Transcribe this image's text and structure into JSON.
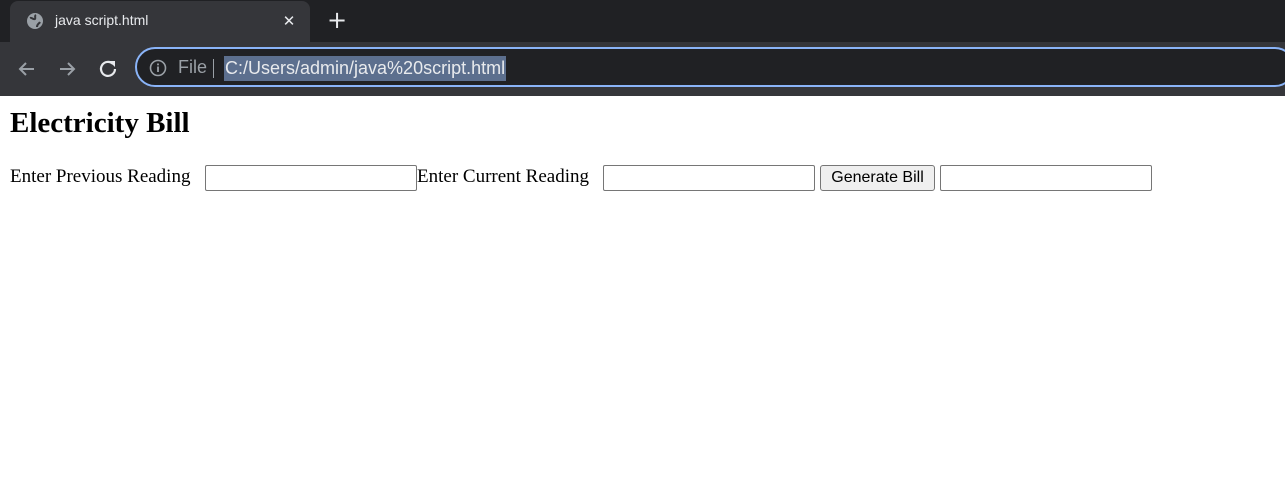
{
  "browser": {
    "tab_title": "java script.html",
    "tab_close": "✕",
    "new_tab": "+",
    "omnibox_scheme": "File",
    "url": "C:/Users/admin/java%20script.html",
    "icons": [
      "globe-icon",
      "close-icon",
      "plus-icon",
      "back-arrow-icon",
      "forward-arrow-icon",
      "reload-icon",
      "info-icon"
    ]
  },
  "page": {
    "heading": "Electricity Bill",
    "previous_label": "Enter Previous Reading",
    "previous_value": "",
    "current_label": "Enter Current Reading",
    "current_value": "",
    "button_label": "Generate Bill",
    "result_value": ""
  },
  "colors": {
    "titlebar": "#202124",
    "toolbar": "#35363a",
    "omnibox_focus": "#8ab4f8",
    "url_selection": "#5c6f8e"
  }
}
